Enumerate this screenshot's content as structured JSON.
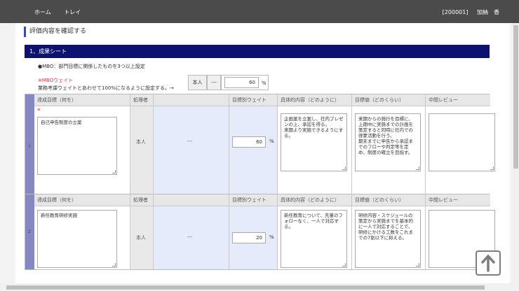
{
  "nav": {
    "home": "ホーム",
    "tray": "トレイ"
  },
  "user": {
    "id": "[200001]",
    "name": "加納　香"
  },
  "page_title": "評価内容を確認する",
  "section_title": "1、成果シート",
  "mbo_note": "●MBO：部門目標に関係したものを3つ以上設定",
  "weight": {
    "title": "※MBOウェイト",
    "desc": "業務考課ウェイトとあわせて100%になるように設定する。→",
    "label": "本人",
    "dash": "---",
    "value": "60",
    "unit": "%"
  },
  "columns": {
    "goal": "達成目標（何を）",
    "person": "処理者",
    "weight": "目標別ウェイト",
    "how": "具体的内容（どのように）",
    "level": "目標値（どのくらい）",
    "review": "中間レビュー"
  },
  "rows": [
    {
      "num": "1",
      "required": "*",
      "goal": "自己申告制度の立案",
      "person": "本人",
      "dash": "---",
      "weight": "60",
      "unit": "%",
      "how": "企画案を立案し、社内プレゼンの上、承認を得る。\n来期より実施できるようにする。",
      "level": "来期からの施行を目標に、上期中に実施までの計画を策定すると同時に社内での啓蒙活動を行う。\n期末までに申告から承認までのフローや判定等を定め、制度の確立を目指す。",
      "review": ""
    },
    {
      "num": "2",
      "goal": "新任教育研修実施",
      "person": "本人",
      "dash": "---",
      "weight": "20",
      "unit": "%",
      "how": "新任教育について、先輩のフォローなく、一人で対応する。",
      "level": "研修内容・スケジュールの策定から実施までを基本的に一人で対応することで、研修にかける工数をこれまでの7割以下に抑える。",
      "review": ""
    }
  ]
}
